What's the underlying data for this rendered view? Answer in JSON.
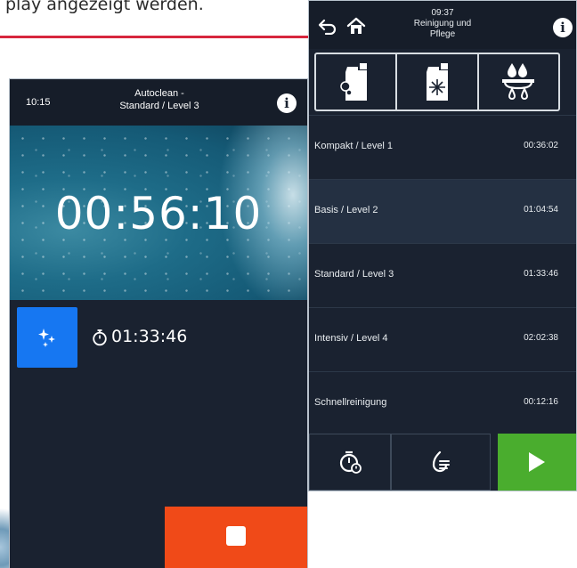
{
  "document": {
    "caption_fragment": "play angezeigt werden."
  },
  "autoclean_screen": {
    "clock": "10:15",
    "title_line1": "Autoclean -",
    "title_line2": "Standard / Level 3",
    "timer": "00:56:10",
    "total_duration": "01:33:46",
    "icons": [
      "info-icon",
      "sparkle-icon",
      "stopwatch-icon",
      "stop-icon"
    ],
    "colors": {
      "clean_button": "#1677f2",
      "stop_button": "#f04a18"
    }
  },
  "care_screen": {
    "clock": "09:37",
    "title_line1": "Reinigung und",
    "title_line2": "Pflege",
    "icons": [
      "back-icon",
      "home-icon",
      "info-icon",
      "cleaner-canister-icon",
      "rinse-canister-icon",
      "water-drops-icon",
      "timer-icon",
      "steam-icon",
      "play-icon"
    ],
    "programs": [
      {
        "name": "Kompakt / Level 1",
        "duration": "00:36:02"
      },
      {
        "name": "Basis / Level 2",
        "duration": "01:04:54"
      },
      {
        "name": "Standard / Level 3",
        "duration": "01:33:46"
      },
      {
        "name": "Intensiv / Level 4",
        "duration": "02:02:38"
      },
      {
        "name": "Schnellreinigung",
        "duration": "00:12:16"
      }
    ],
    "selected_program": 1,
    "colors": {
      "play_button": "#4aad2e"
    }
  }
}
